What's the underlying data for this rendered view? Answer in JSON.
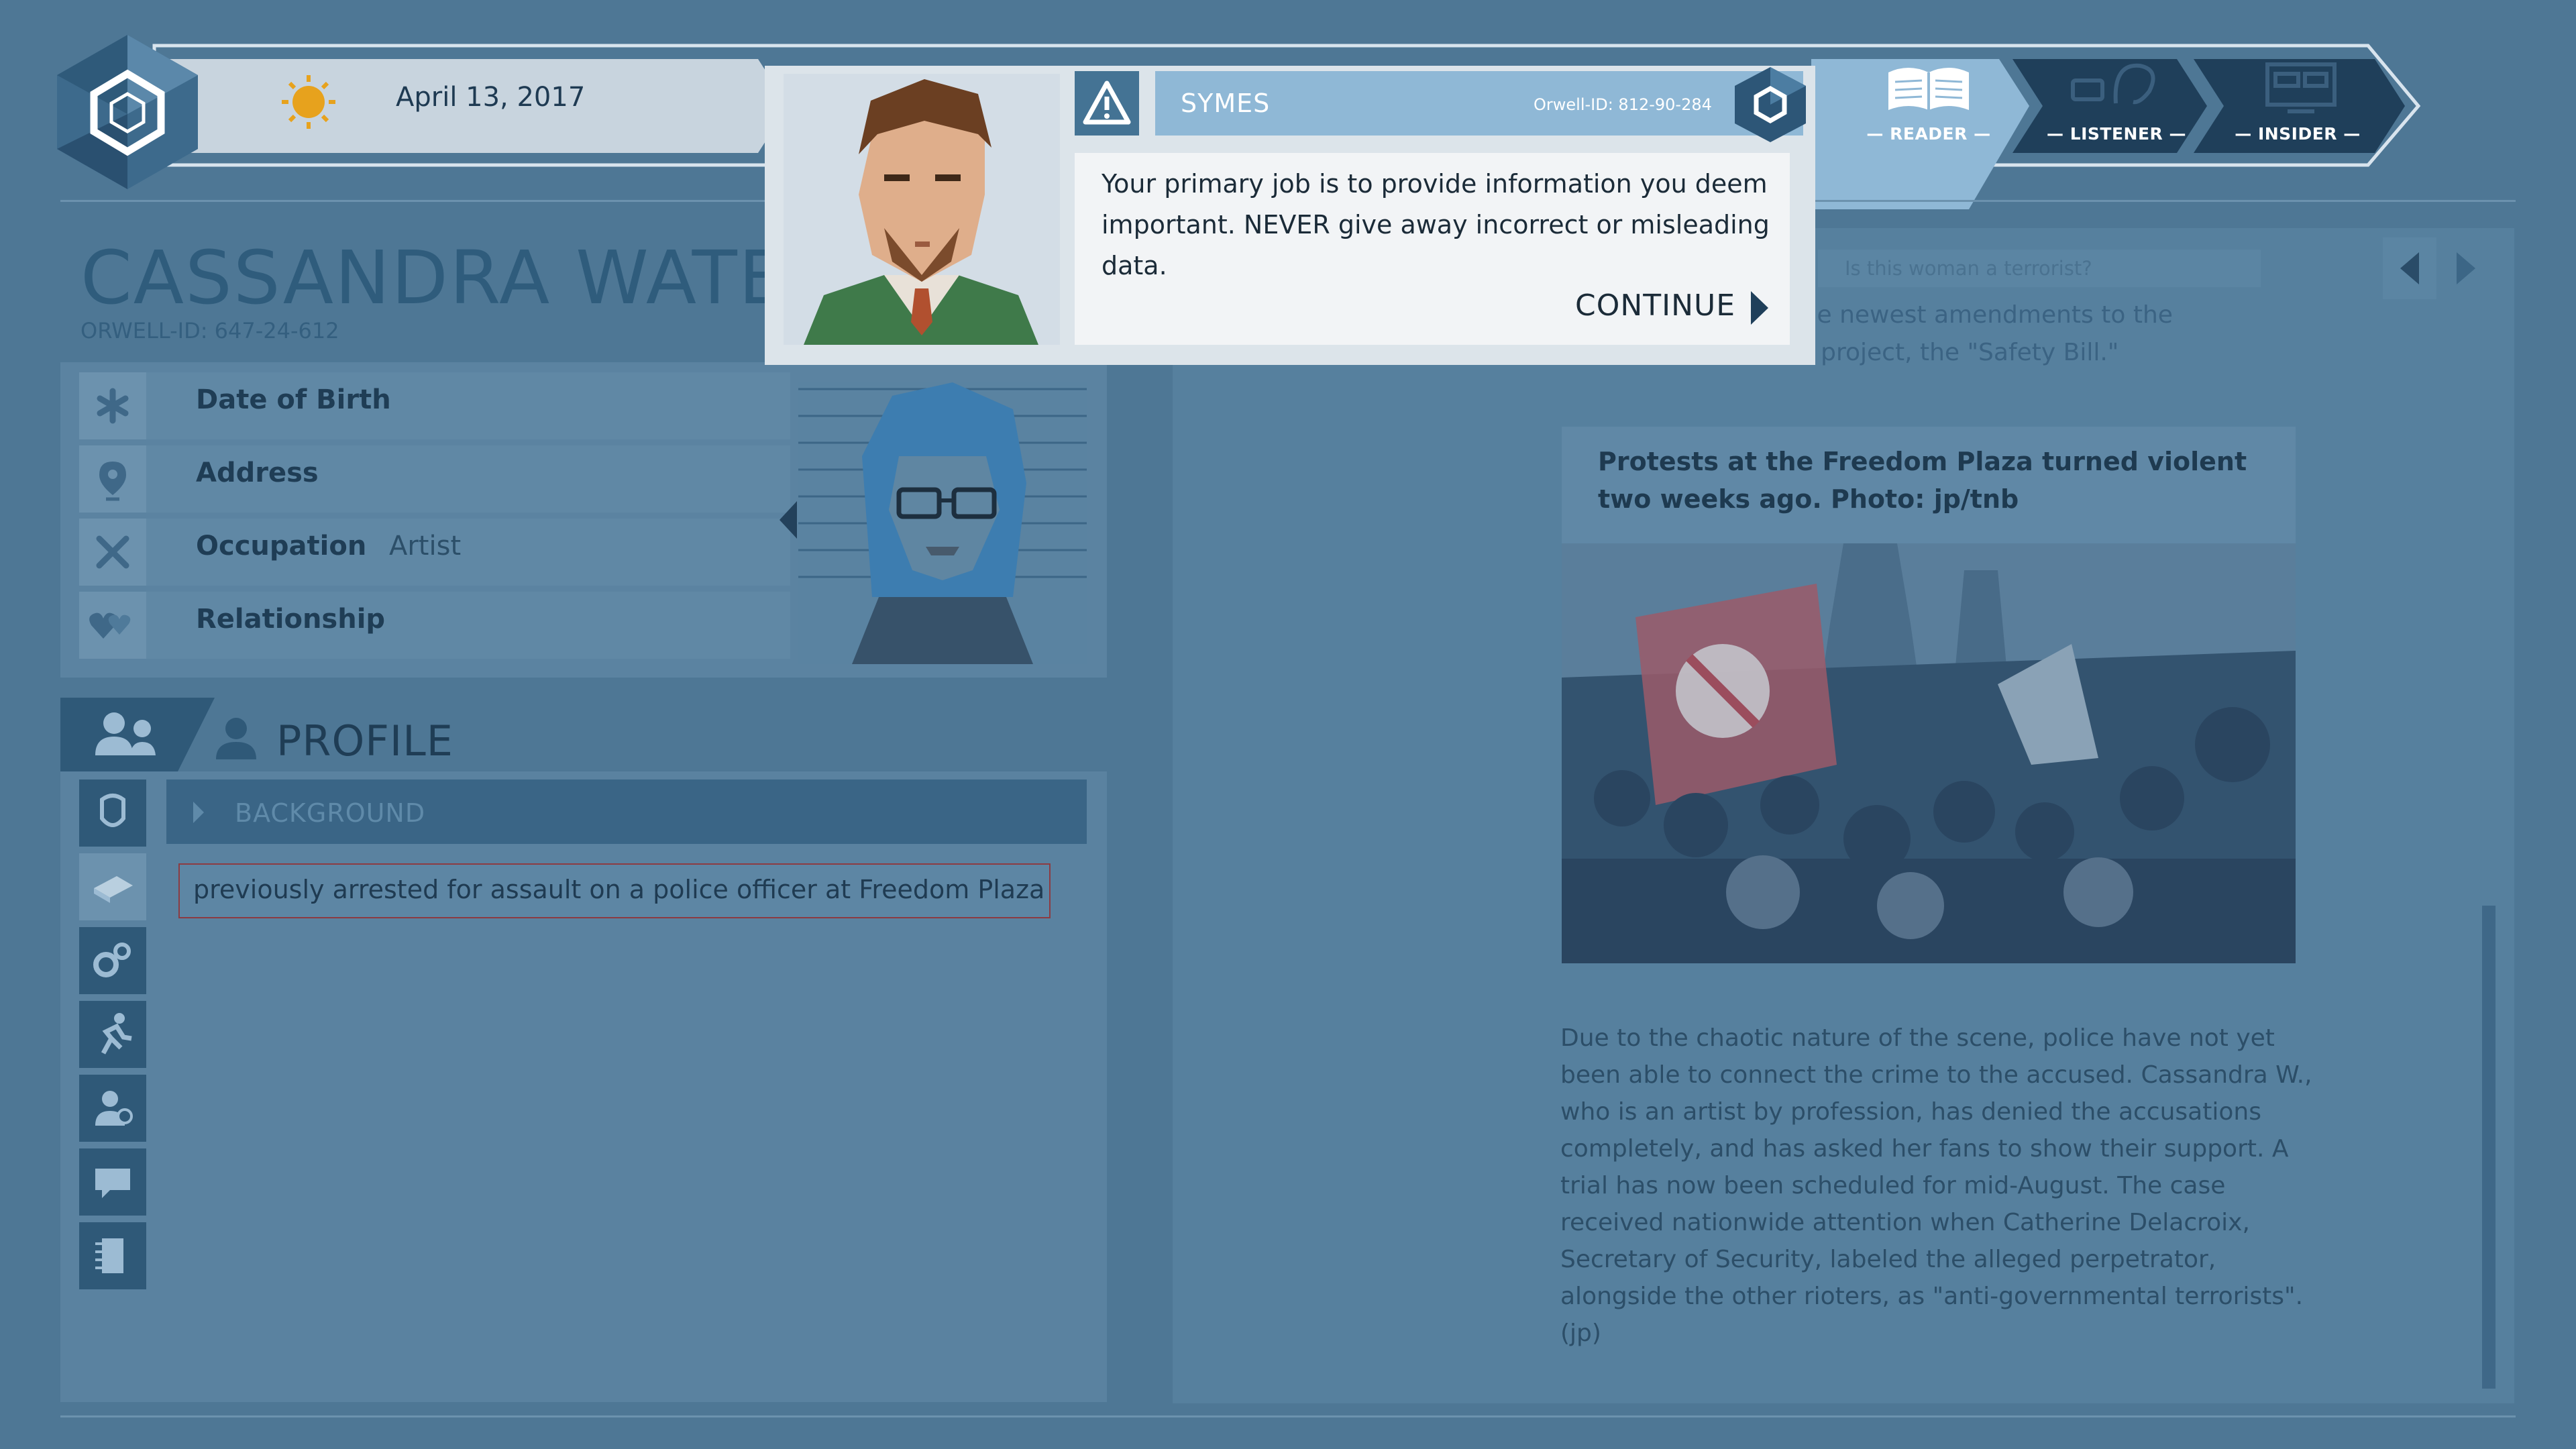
{
  "topbar": {
    "date": "April 13, 2017",
    "weather_icon": "sun-icon",
    "stages": [
      {
        "label": "— READER —",
        "icon": "book-icon",
        "active": true
      },
      {
        "label": "— LISTENER —",
        "icon": "ear-phone-icon",
        "active": false
      },
      {
        "label": "— INSIDER —",
        "icon": "computer-icon",
        "active": false
      }
    ]
  },
  "profile": {
    "name": "CASSANDRA WATERC",
    "orwell_id": "ORWELL-ID: 647-24-612",
    "fields": [
      {
        "label": "Date of Birth",
        "value": "",
        "icon": "asterisk-icon"
      },
      {
        "label": "Address",
        "value": "",
        "icon": "location-pin-icon"
      },
      {
        "label": "Occupation",
        "value": "Artist",
        "icon": "tools-icon"
      },
      {
        "label": "Relationship",
        "value": "",
        "icon": "hearts-icon"
      }
    ],
    "section_title": "PROFILE",
    "category": "BACKGROUND",
    "facts": [
      "previously arrested for assault on a police officer at Freedom Plaza"
    ]
  },
  "reader": {
    "search_placeholder": "Is this woman a terrorist?",
    "article_top_lines": [
      "t the newest amendments to the",
      "Government's model project, the \"Safety Bill.\""
    ],
    "photo_caption": "Protests at the Freedom Plaza turned violent two weeks ago. Photo: jp/tnb",
    "article_body": "Due to the chaotic nature of the scene, police have not yet been able to connect the crime to the accused. Cassandra W., who is an artist by profession, has denied the accusations completely, and has asked her fans to show their support. A trial has now been scheduled for mid-August. The case received nationwide attention when Catherine Delacroix, Secretary of Security, labeled the alleged perpetrator, alongside the other rioters, as \"anti-governmental terrorists\".(jp)"
  },
  "message": {
    "sender": "SYMES",
    "sender_orwell_id": "Orwell-ID: 812-90-284",
    "text": "Your primary job is to provide information you deem important. NEVER give away incorrect or misleading data.",
    "continue_label": "CONTINUE"
  },
  "colors": {
    "background": "#4e7795",
    "popup_frame": "#dce4ea",
    "sender_bar": "#8fb8d6",
    "fact_border": "#8c3b42",
    "active_stage": "#8fb8d6"
  }
}
